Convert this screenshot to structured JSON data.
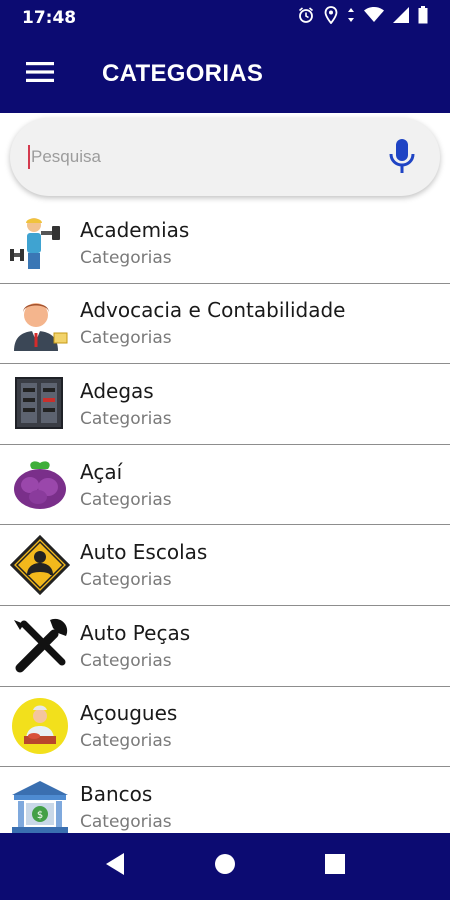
{
  "status_bar": {
    "time": "17:48"
  },
  "app_bar": {
    "title": "CATEGORIAS"
  },
  "search": {
    "placeholder": "Pesquisa"
  },
  "categories": [
    {
      "name": "Academias",
      "subtitle": "Categorias",
      "icon": "gym-trainer-icon"
    },
    {
      "name": "Advocacia e Contabilidade",
      "subtitle": "Categorias",
      "icon": "lawyer-icon"
    },
    {
      "name": "Adegas",
      "subtitle": "Categorias",
      "icon": "wine-cellar-icon"
    },
    {
      "name": "Açaí",
      "subtitle": "Categorias",
      "icon": "acai-bowl-icon"
    },
    {
      "name": "Auto Escolas",
      "subtitle": "Categorias",
      "icon": "driving-school-sign-icon"
    },
    {
      "name": "Auto Peças",
      "subtitle": "Categorias",
      "icon": "wrench-screwdriver-icon"
    },
    {
      "name": "Açougues",
      "subtitle": "Categorias",
      "icon": "butcher-icon"
    },
    {
      "name": "Bancos",
      "subtitle": "Categorias",
      "icon": "bank-icon"
    }
  ],
  "colors": {
    "primary": "#0c0b72",
    "search_bg": "#f1f1f1",
    "mic": "#1f44c4",
    "divider": "#8d8d8d"
  }
}
